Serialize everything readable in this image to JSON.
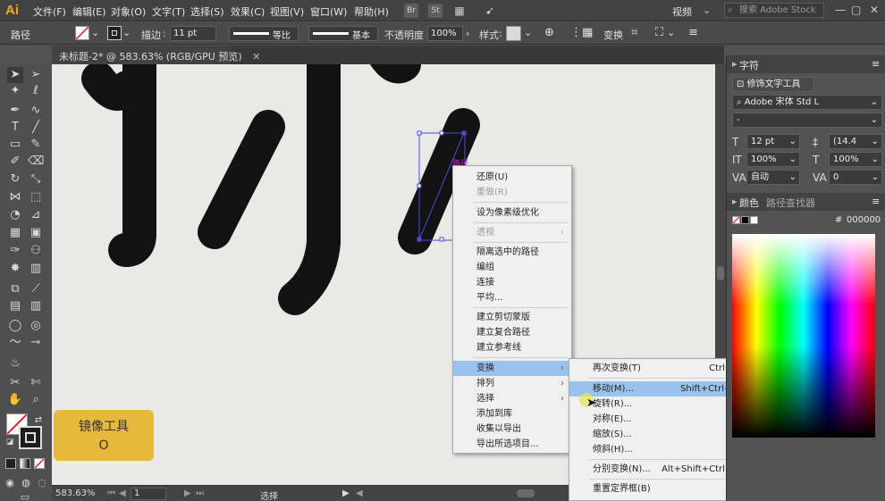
{
  "app": {
    "logo": "Ai"
  },
  "menu": [
    "文件(F)",
    "编辑(E)",
    "对象(O)",
    "文字(T)",
    "选择(S)",
    "效果(C)",
    "视图(V)",
    "窗口(W)",
    "帮助(H)"
  ],
  "menubar": {
    "br_label": "Br",
    "st_label": "St",
    "workspace": "视频",
    "search_placeholder": "搜索 Adobe Stock"
  },
  "control": {
    "selection_label": "路径",
    "stroke_label": "描边",
    "stroke_value": "11 pt",
    "profile_label": "等比",
    "brush_label": "基本",
    "opacity_label": "不透明度",
    "opacity_value": "100%",
    "style_label": "样式",
    "transform_label": "变换"
  },
  "document": {
    "tab_title": "未标题-2* @ 583.63% (RGB/GPU 预览)"
  },
  "canvas": {
    "anchor_label": "路径"
  },
  "status": {
    "zoom": "583.63%",
    "artboard": "1",
    "tool_status": "选择"
  },
  "hint": {
    "title": "镜像工具",
    "key": "O"
  },
  "context_menu": {
    "items": [
      {
        "label": "还原(U)"
      },
      {
        "label": "重做(R)",
        "disabled": true
      },
      {
        "label": "设为像素级优化"
      },
      {
        "label": "透视",
        "disabled": true
      },
      {
        "label": "隔离选中的路径"
      },
      {
        "label": "编组"
      },
      {
        "label": "连接"
      },
      {
        "label": "平均..."
      },
      {
        "label": "建立剪切蒙版"
      },
      {
        "label": "建立复合路径"
      },
      {
        "label": "建立参考线"
      },
      {
        "label": "变换"
      },
      {
        "label": "排列"
      },
      {
        "label": "选择"
      },
      {
        "label": "添加到库"
      },
      {
        "label": "收集以导出"
      },
      {
        "label": "导出所选项目..."
      }
    ]
  },
  "submenu": {
    "items": [
      {
        "label": "再次变换(T)",
        "shortcut": "Ctrl+D"
      },
      {
        "label": "移动(M)...",
        "shortcut": "Shift+Ctrl+M"
      },
      {
        "label": "旋转(R)..."
      },
      {
        "label": "对称(E)..."
      },
      {
        "label": "缩放(S)..."
      },
      {
        "label": "倾斜(H)..."
      },
      {
        "label": "分别变换(N)...",
        "shortcut": "Alt+Shift+Ctrl+D"
      },
      {
        "label": "重置定界框(B)"
      }
    ]
  },
  "char_panel": {
    "tab": "字符",
    "touch_type": "修饰文字工具",
    "font_family": "Adobe 宋体 Std L",
    "font_style": "-",
    "font_size": "12 pt",
    "leading": "(14.4",
    "vscale": "100%",
    "hscale": "100%",
    "kerning": "自动",
    "tracking": "0"
  },
  "color_panel": {
    "tab_color": "颜色",
    "tab_pathfinder": "路径查找器",
    "hex": "000000"
  },
  "colors": {
    "accent_yellow": "#e6b93a",
    "highlight": "#99c3ec",
    "selection": "#4b4bd6",
    "ink": "#121212"
  }
}
